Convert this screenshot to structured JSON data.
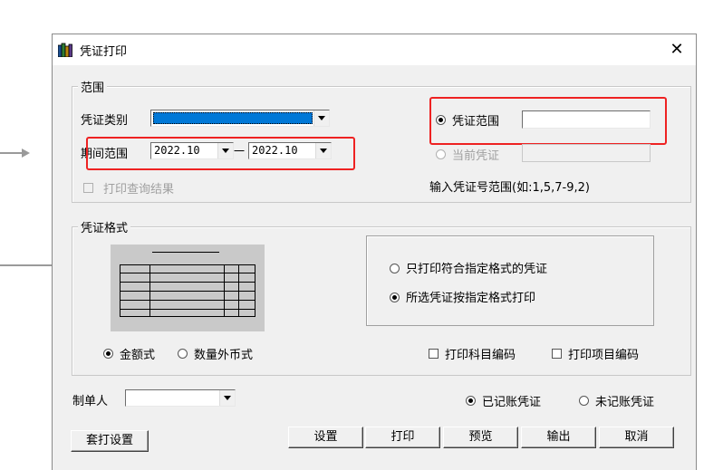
{
  "dialog": {
    "title": "凭证打印",
    "close_glyph": "✕"
  },
  "range_group": {
    "legend": "范围",
    "voucher_type_label": "凭证类别",
    "voucher_type_value": "",
    "period_label": "期间范围",
    "period_from": "2022.10",
    "period_separator": "一",
    "period_to": "2022.10",
    "print_query_result_label": "打印查询结果",
    "print_query_result_checked": false,
    "voucher_range_label": "凭证范围",
    "voucher_range_value": "",
    "current_voucher_label": "当前凭证",
    "range_hint": "输入凭证号范围(如:1,5,7-9,2)"
  },
  "format_group": {
    "legend": "凭证格式",
    "option_specified_only": "只打印符合指定格式的凭证",
    "option_all_by_format": "所选凭证按指定格式打印",
    "amount_style_label": "金额式",
    "foreign_currency_label": "数量外币式",
    "print_subject_code_label": "打印科目编码",
    "print_item_code_label": "打印项目编码"
  },
  "bottom": {
    "maker_label": "制单人",
    "maker_value": "",
    "posted_label": "已记账凭证",
    "unposted_label": "未记账凭证"
  },
  "buttons": {
    "template_setup": "套打设置",
    "settings": "设置",
    "print": "打印",
    "preview": "预览",
    "export": "输出",
    "cancel": "取消"
  },
  "colors": {
    "highlight_red": "#e22222",
    "selection_blue": "#0078d7",
    "dialog_bg": "#f0f0f0"
  }
}
